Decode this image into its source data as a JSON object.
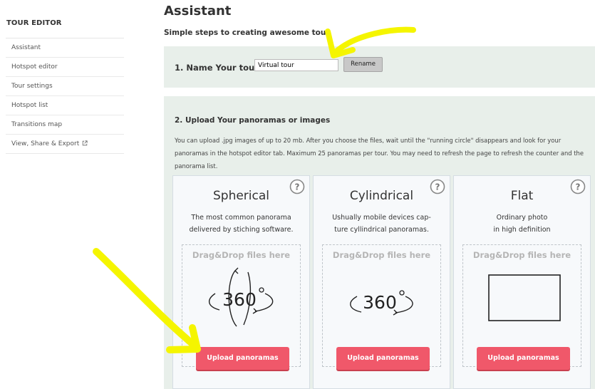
{
  "sidebar": {
    "title": "TOUR EDITOR",
    "items": [
      {
        "label": "Assistant"
      },
      {
        "label": "Hotspot editor"
      },
      {
        "label": "Tour settings"
      },
      {
        "label": "Hotspot list"
      },
      {
        "label": "Transitions map"
      },
      {
        "label": "View, Share & Export",
        "icon": "external-link-icon"
      }
    ]
  },
  "main": {
    "title": "Assistant",
    "subtitle": "Simple steps to creating awesome tour"
  },
  "name_step": {
    "label": "1. Name Your tour:",
    "input_value": "Virtual tour",
    "rename_label": "Rename"
  },
  "upload_step": {
    "heading": "2. Upload Your panoramas or images",
    "description": "You can upload .jpg images of up to 20 mb. After you choose the files, wait until the \"running circle\" disappears and look for your panoramas in the hotspot editor tab. Maximum 25 panoramas per tour. You may need to refresh the page to refresh the counter and the panorama list.",
    "cards": [
      {
        "title": "Spherical",
        "description": "The most common panorama\ndelivered by stiching software.",
        "dropzone_label": "Drag&Drop files here",
        "icon": "spherical-360-icon",
        "icon_text": "360",
        "button_label": "Upload panoramas"
      },
      {
        "title": "Cylindrical",
        "description": "Ushually mobile devices cap-\nture cyllindrical panoramas.",
        "dropzone_label": "Drag&Drop files here",
        "icon": "cylindrical-360-icon",
        "icon_text": "360",
        "button_label": "Upload panoramas"
      },
      {
        "title": "Flat",
        "description": "Ordinary photo\nin high definition",
        "dropzone_label": "Drag&Drop files here",
        "icon": "flat-rectangle-icon",
        "button_label": "Upload panoramas"
      }
    ]
  },
  "colors": {
    "panel_bg": "#e8efea",
    "upload_button": "#f0586a",
    "annotation_arrow": "#f5f500"
  }
}
